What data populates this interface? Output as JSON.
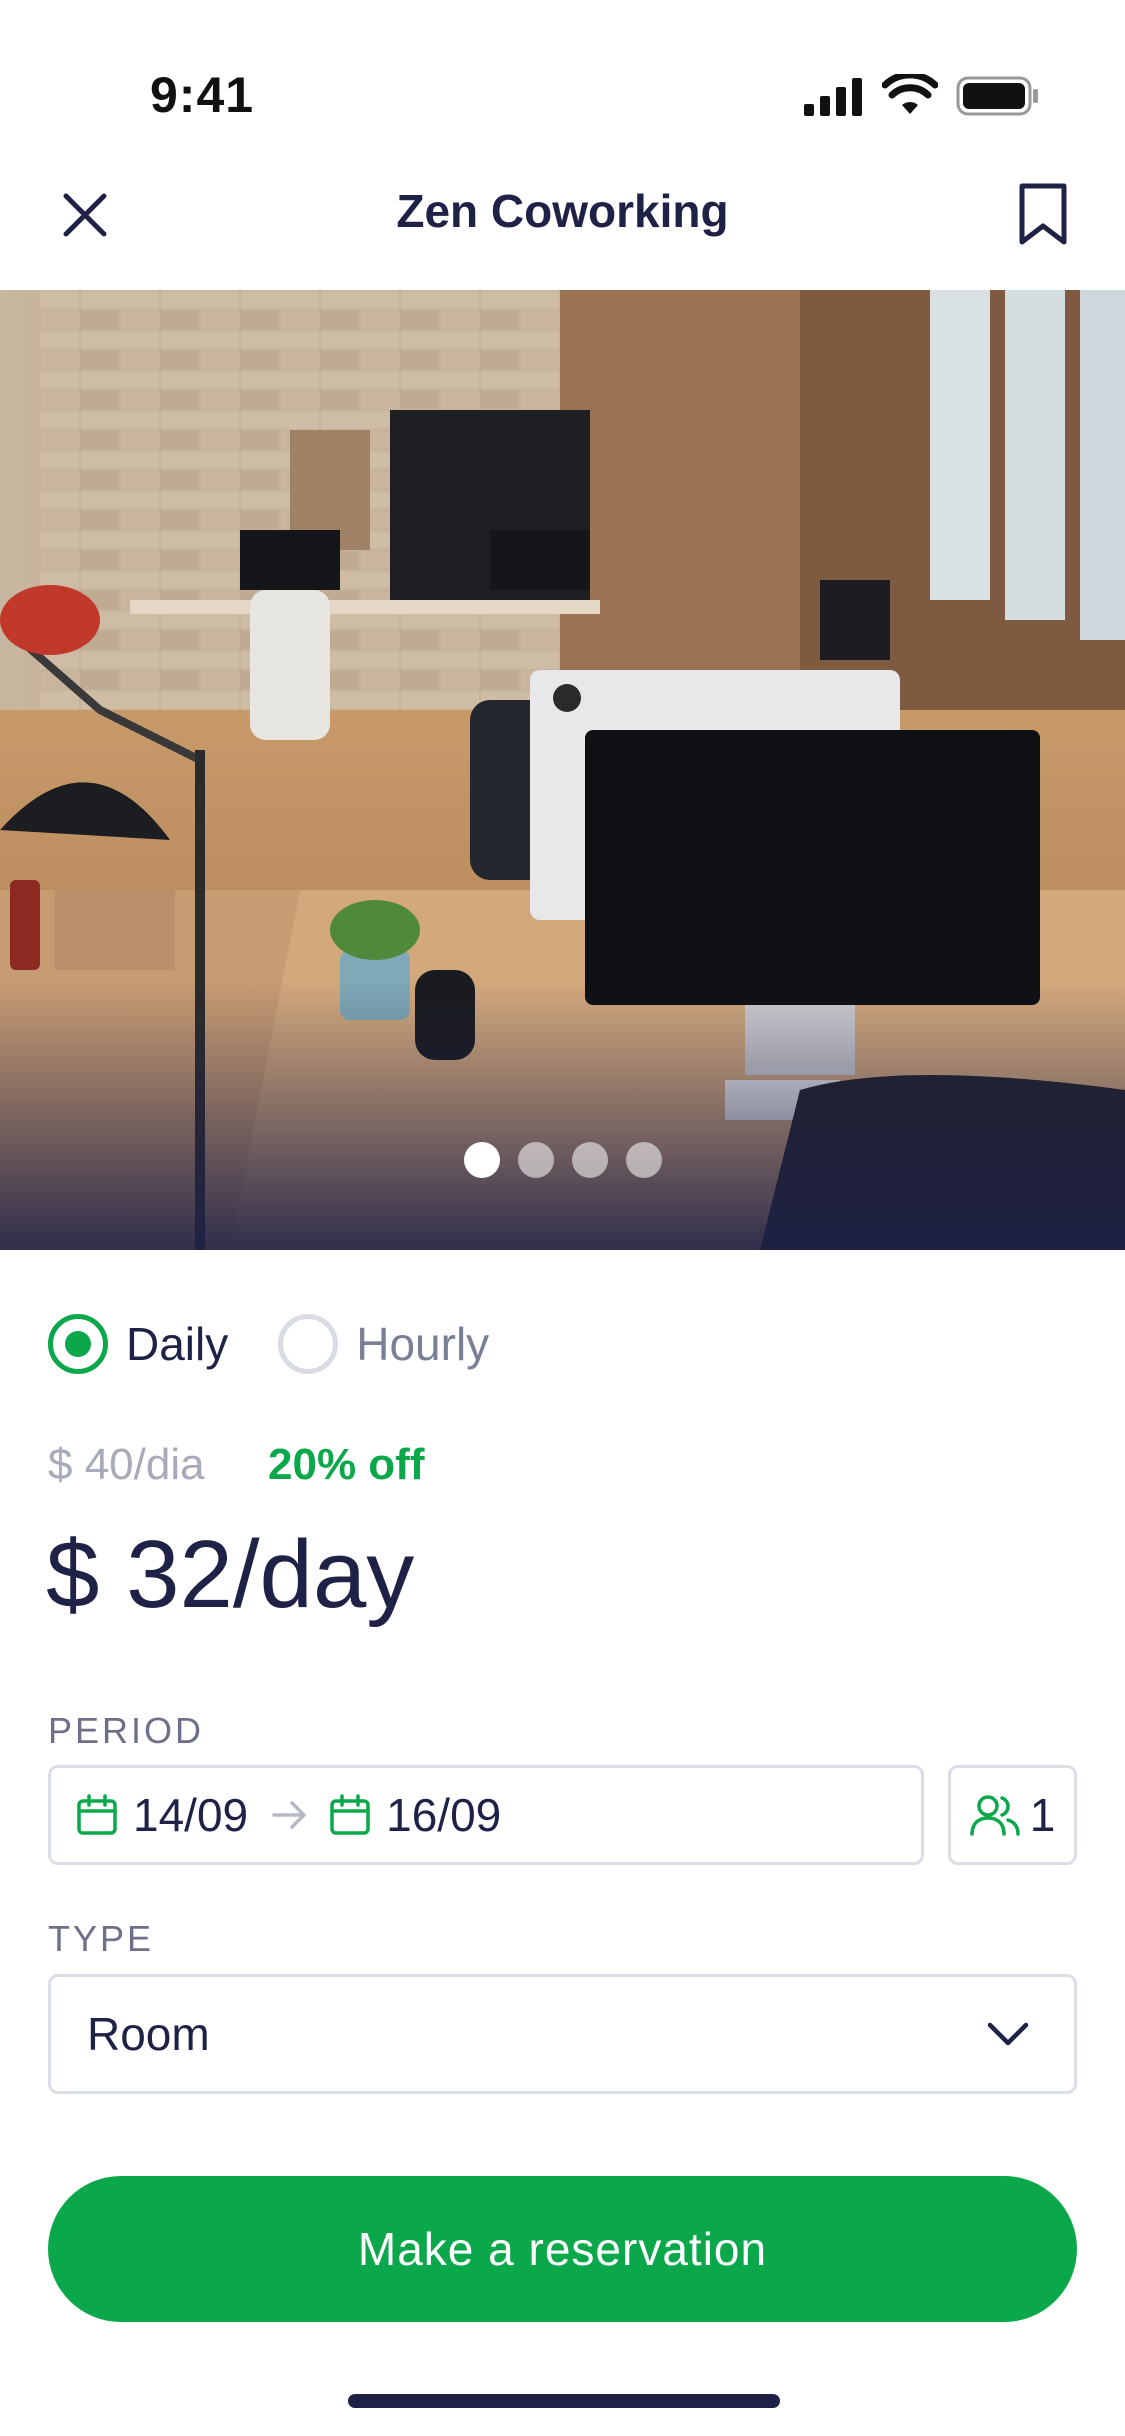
{
  "status_bar": {
    "time": "9:41",
    "icons": [
      "signal-icon",
      "wifi-icon",
      "battery-icon"
    ]
  },
  "header": {
    "title": "Zen Coworking",
    "left_icon": "close-icon",
    "right_icon": "bookmark-icon"
  },
  "gallery": {
    "image": "coworking office photo",
    "dot_count": 4,
    "active_index": 0
  },
  "rate_options": [
    {
      "label": "Daily",
      "selected": true
    },
    {
      "label": "Hourly",
      "selected": false
    }
  ],
  "pricing": {
    "original": "$ 40/dia",
    "discount": "20% off",
    "current": "$ 32/day"
  },
  "period": {
    "label": "PERIOD",
    "start": "14/09",
    "end": "16/09",
    "guests": "1"
  },
  "type": {
    "label": "TYPE",
    "value": "Room"
  },
  "cta": {
    "label": "Make a reservation"
  },
  "colors": {
    "accent": "#0aa84a",
    "text": "#1f2147",
    "muted": "#a7aab9",
    "border": "#dcdee6"
  }
}
